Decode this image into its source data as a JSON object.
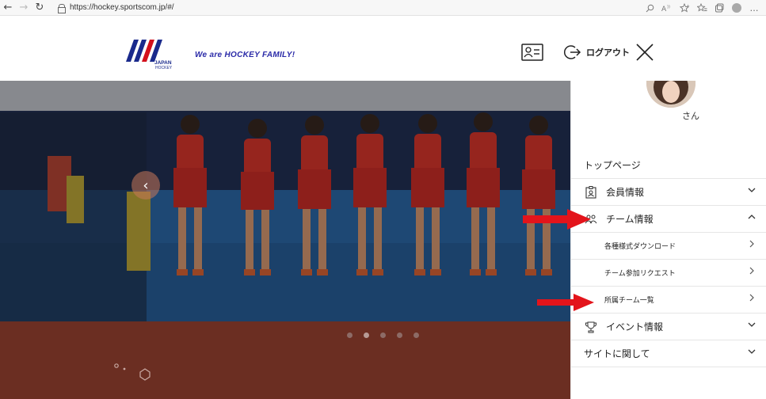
{
  "browser": {
    "url": "https://hockey.sportscom.jp/#/",
    "back_icon": "back-arrow-icon",
    "forward_icon": "forward-arrow-icon",
    "reload_icon": "reload-icon",
    "toolbar_icons": [
      "search-icon",
      "read-aloud-icon",
      "favorites-add-icon",
      "favorites-icon",
      "collections-icon",
      "profile-icon",
      "more-icon"
    ],
    "more_glyph": "…"
  },
  "header": {
    "tagline": "We are HOCKEY FAMILY!",
    "logo_lines": [
      "JAPAN",
      "HOCKEY"
    ],
    "logout_label": "ログアウト",
    "colors": {
      "brand_blue": "#1a2a8c",
      "brand_red": "#d3101c"
    }
  },
  "hero": {
    "prev_label": "‹",
    "slide_count": 5,
    "active_slide": 1,
    "band_color": "#6b2e22"
  },
  "sidebar": {
    "user_suffix": "さん",
    "menu": [
      {
        "label": "トップページ",
        "icon": "",
        "expandable": false
      },
      {
        "label": "会員情報",
        "icon": "id-badge-icon",
        "expandable": true,
        "expanded": false
      },
      {
        "label": "チーム情報",
        "icon": "team-icon",
        "expandable": true,
        "expanded": true
      },
      {
        "label": "イベント情報",
        "icon": "trophy-icon",
        "expandable": true,
        "expanded": false
      },
      {
        "label": "サイトに関して",
        "icon": "",
        "expandable": true,
        "expanded": false
      }
    ],
    "submenu": [
      {
        "label": "各種様式ダウンロード"
      },
      {
        "label": "チーム参加リクエスト"
      },
      {
        "label": "所属チーム一覧"
      }
    ]
  },
  "annotations": {
    "arrow_color": "#e3141b"
  }
}
